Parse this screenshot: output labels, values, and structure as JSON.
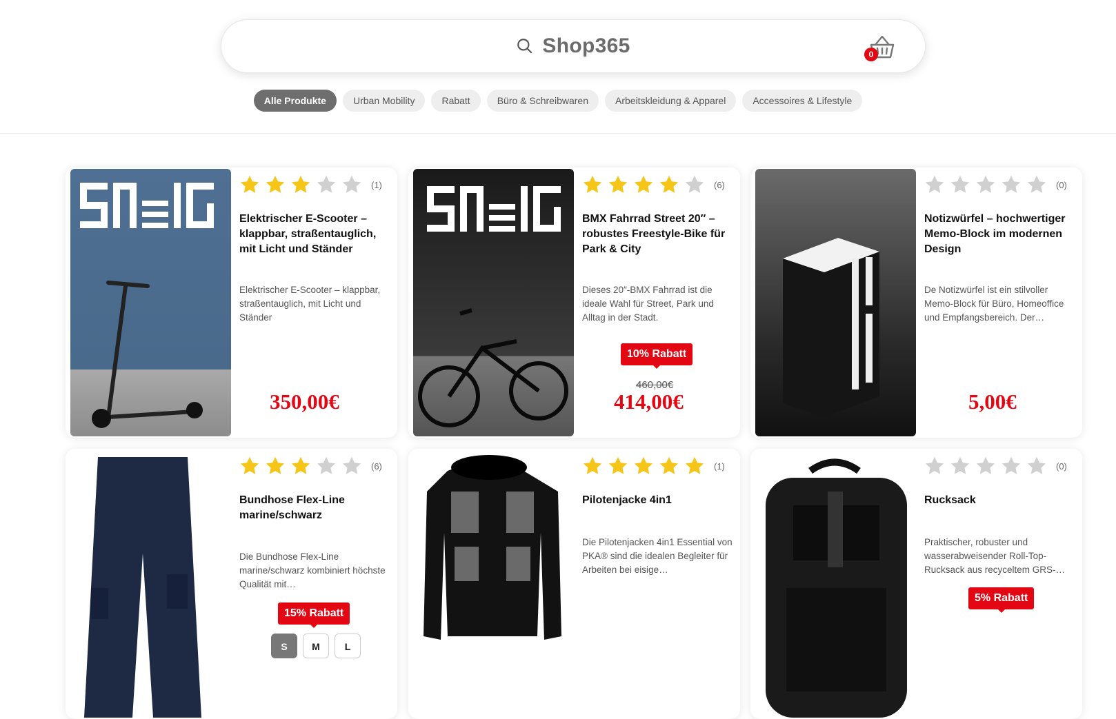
{
  "header": {
    "brand": "Shop365",
    "cart_count": "0"
  },
  "categories": [
    {
      "label": "Alle Produkte",
      "active": true
    },
    {
      "label": "Urban Mobility",
      "active": false
    },
    {
      "label": "Rabatt",
      "active": false
    },
    {
      "label": "Büro & Schreibwaren",
      "active": false
    },
    {
      "label": "Arbeitskleidung & Apparel",
      "active": false
    },
    {
      "label": "Accessoires & Lifestyle",
      "active": false
    }
  ],
  "products": [
    {
      "rating": 3,
      "count": "(1)",
      "title": "Elektrischer E-Scooter – klappbar, straßentauglich, mit Licht und Ständer",
      "desc": "Elektrischer E-Scooter – klappbar, straßentauglich, mit Licht und Ständer",
      "badge": "",
      "old_price": "",
      "price": "350,00€"
    },
    {
      "rating": 4,
      "count": "(6)",
      "title": "BMX Fahrrad Street 20″ – robustes Freestyle-Bike für Park & City",
      "desc": "Dieses 20″-BMX Fahrrad ist die ideale Wahl für Street, Park und Alltag in der Stadt.",
      "badge": "10% Rabatt",
      "old_price": "460,00€",
      "price": "414,00€"
    },
    {
      "rating": 0,
      "count": "(0)",
      "title": "Notizwürfel – hochwertiger Memo-Block im modernen Design",
      "desc": "De Notizwürfel ist ein stilvoller Memo-Block für Büro, Homeoffice und Empfangsbereich. Der…",
      "badge": "",
      "old_price": "",
      "price": "5,00€"
    },
    {
      "rating": 3,
      "count": "(6)",
      "title": "Bundhose Flex-Line marine/schwarz",
      "desc": "Die Bundhose Flex-Line marine/schwarz kombiniert höchste Qualität mit…",
      "badge": "15% Rabatt",
      "old_price": "",
      "price": "",
      "sizes": [
        "S",
        "M",
        "L"
      ]
    },
    {
      "rating": 5,
      "count": "(1)",
      "title": "Pilotenjacke 4in1",
      "desc": "Die Pilotenjacken 4in1 Essential von PKA® sind die idealen Begleiter für Arbeiten bei eisige…",
      "badge": "",
      "old_price": "",
      "price": ""
    },
    {
      "rating": 0,
      "count": "(0)",
      "title": "Rucksack",
      "desc": "Praktischer, robuster und wasserabweisender Roll-Top-Rucksack aus recyceltem GRS-…",
      "badge": "5% Rabatt",
      "old_price": "",
      "price": ""
    }
  ],
  "colors": {
    "accent": "#e30613",
    "star_on": "#f5c518",
    "star_off": "#d0d0d0"
  }
}
